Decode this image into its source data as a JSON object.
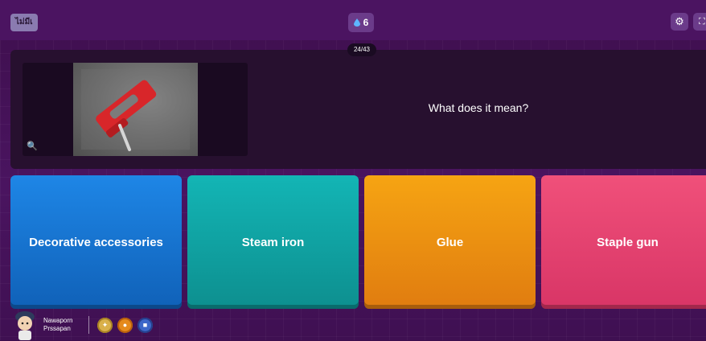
{
  "header": {
    "quit_label": "ไม่มีเ",
    "streak_count": "6",
    "settings_icon": "gear-icon",
    "fullscreen_icon": "fullscreen-icon"
  },
  "progress": {
    "counter": "24/43"
  },
  "question": {
    "text": "What does it mean?",
    "zoom_icon": "zoom-in-icon"
  },
  "options": [
    {
      "label": "Decorative accessories",
      "color": "#1e86e6"
    },
    {
      "label": "Steam iron",
      "color": "#13b5b5"
    },
    {
      "label": "Glue",
      "color": "#f6a412"
    },
    {
      "label": "Staple gun",
      "color": "#f0507a"
    }
  ],
  "player": {
    "first_name": "Nawaporn",
    "last_name": "Prssapan",
    "powerups": [
      "streak-saver-icon",
      "fire-icon",
      "shield-icon"
    ]
  },
  "theme": {
    "background": "#4a1460",
    "panel": "#27102f"
  }
}
